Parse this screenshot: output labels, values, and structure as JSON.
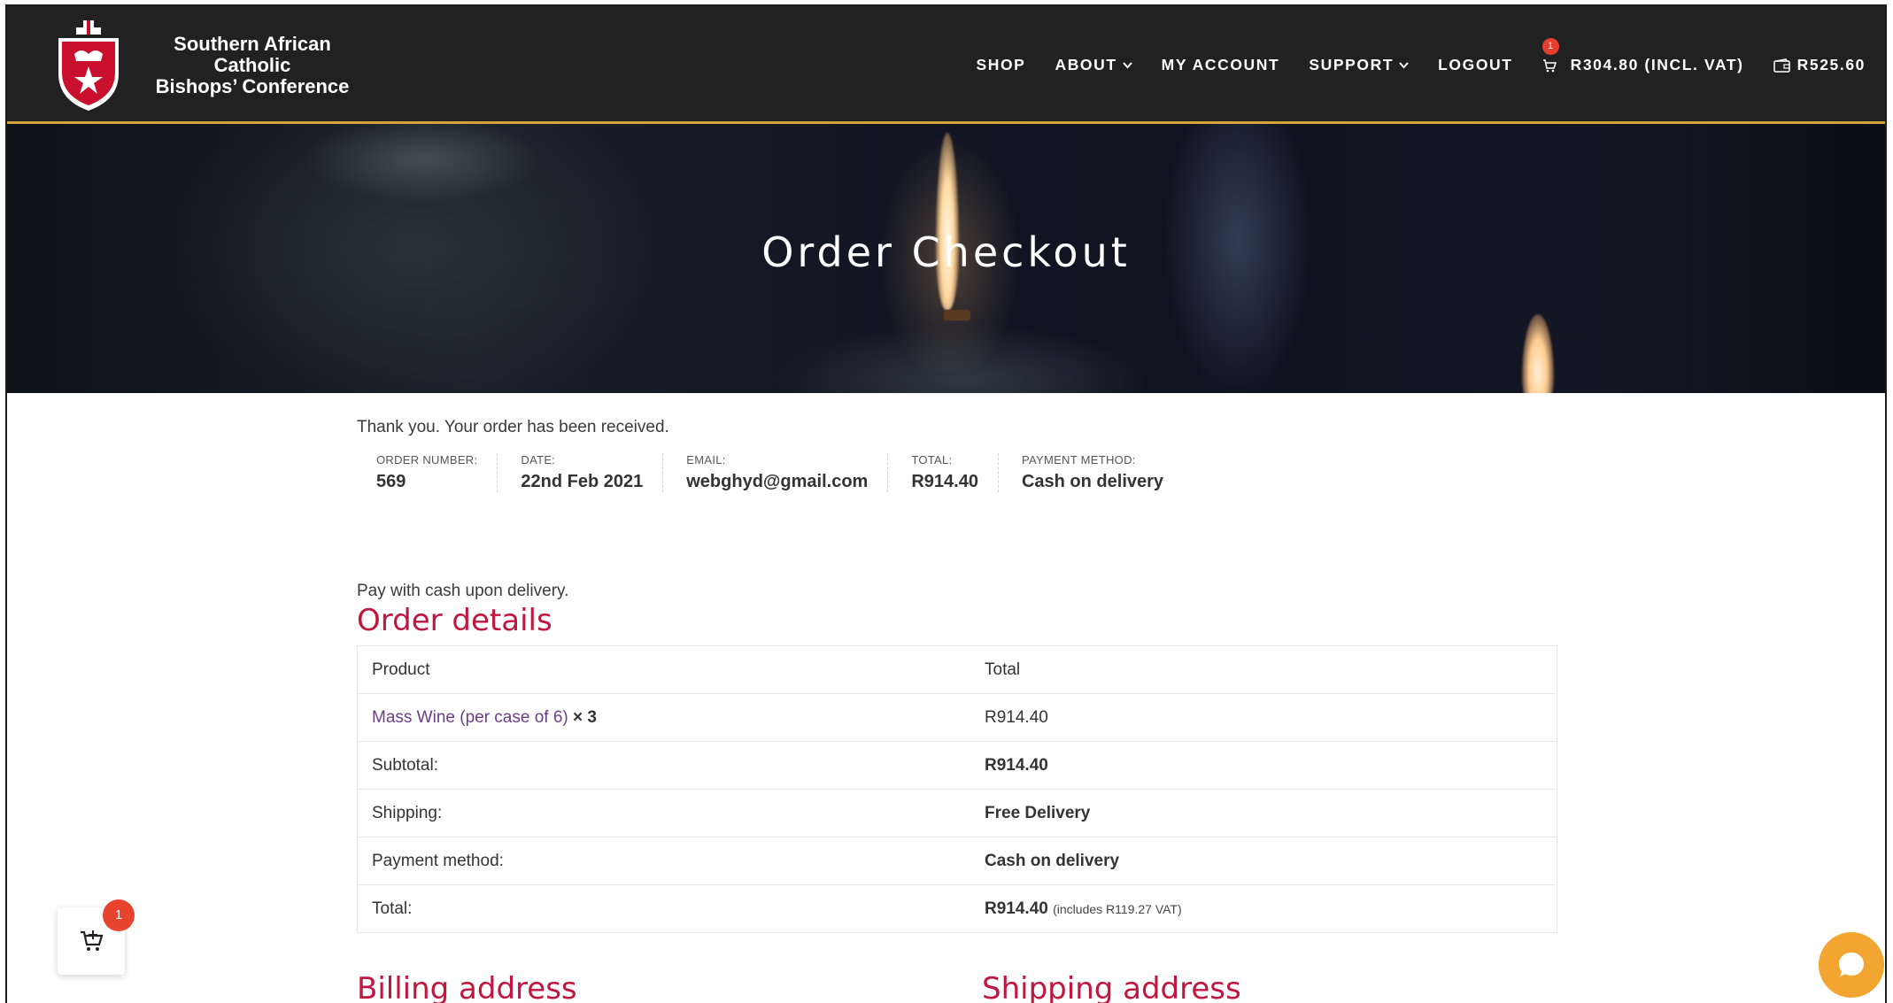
{
  "brand": {
    "line1": "Southern African Catholic",
    "line2": "Bishops’ Conference"
  },
  "nav": {
    "shop": "SHOP",
    "about": "ABOUT",
    "my_account": "MY ACCOUNT",
    "support": "SUPPORT",
    "logout": "LOGOUT",
    "cart_count": "1",
    "cart_total": "R304.80 (INCL. VAT)",
    "wallet_balance": "R525.60"
  },
  "hero": {
    "title": "Order Checkout"
  },
  "order": {
    "thank_you": "Thank you. Your order has been received.",
    "overview": [
      {
        "label": "ORDER NUMBER:",
        "value": "569"
      },
      {
        "label": "DATE:",
        "value": "22nd Feb 2021"
      },
      {
        "label": "EMAIL:",
        "value": "webghyd@gmail.com"
      },
      {
        "label": "TOTAL:",
        "value": "R914.40"
      },
      {
        "label": "PAYMENT METHOD:",
        "value": "Cash on delivery"
      }
    ],
    "payment_note": "Pay with cash upon delivery."
  },
  "order_details": {
    "heading": "Order details",
    "header": {
      "product": "Product",
      "total": "Total"
    },
    "item": {
      "name": "Mass Wine (per case of 6)",
      "qty": "× 3",
      "total": "R914.40"
    },
    "rows": [
      {
        "label": "Subtotal:",
        "value": "R914.40"
      },
      {
        "label": "Shipping:",
        "value": "Free Delivery"
      },
      {
        "label": "Payment method:",
        "value": "Cash on delivery"
      }
    ],
    "total": {
      "label": "Total:",
      "value": "R914.40",
      "note": "(includes R119.27 VAT)"
    }
  },
  "addresses": {
    "billing": "Billing address",
    "shipping": "Shipping address"
  },
  "floating": {
    "cart_badge": "1"
  },
  "colors": {
    "header_bg": "#212121",
    "accent_line": "#d8a23a",
    "heading_red": "#c0163f",
    "link_purple": "#6b3d86",
    "chat_orange": "#f2a531",
    "badge_red": "#e8432e"
  }
}
